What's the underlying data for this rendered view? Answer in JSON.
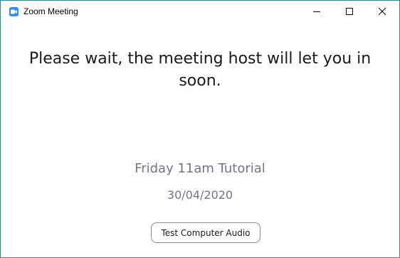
{
  "window": {
    "title": "Zoom Meeting",
    "icon": "zoom-camera-icon",
    "accent_color": "#2d8cff",
    "border_color": "#2b8a8a"
  },
  "title_controls": {
    "minimize": "minimize-icon",
    "maximize": "maximize-icon",
    "close": "close-icon"
  },
  "waiting_room": {
    "message": "Please wait, the meeting host will let you in soon.",
    "meeting_name": "Friday 11am Tutorial",
    "meeting_date": "30/04/2020",
    "text_color": "#747487"
  },
  "actions": {
    "test_audio_label": "Test Computer Audio"
  }
}
